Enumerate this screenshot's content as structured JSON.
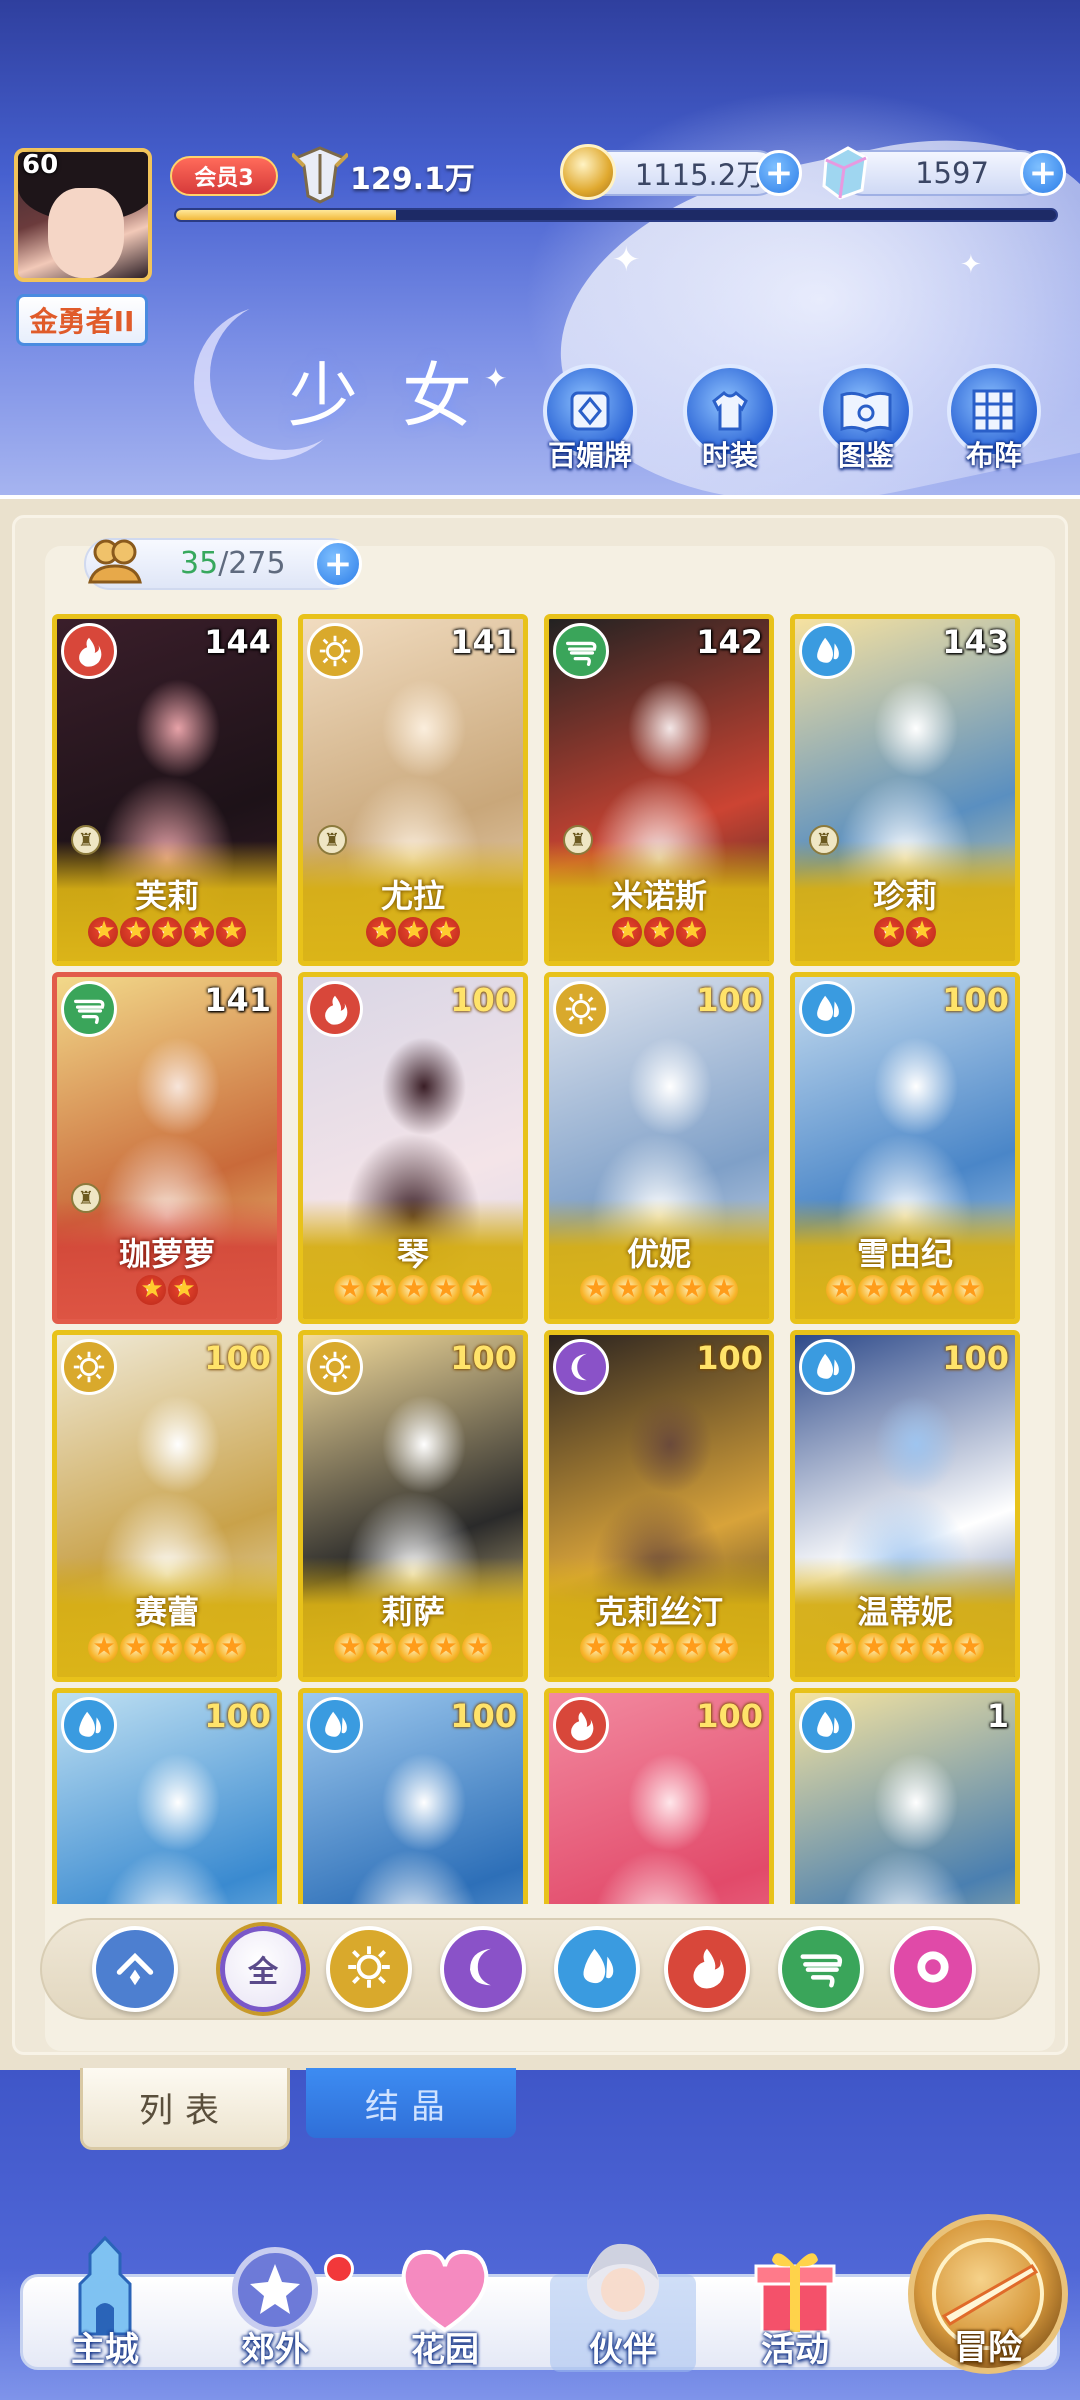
{
  "player": {
    "level": "60",
    "rank": "金勇者II",
    "vip": "会员3",
    "power": "129.1万",
    "exp_progress": 0.25
  },
  "resources": {
    "gold": "1115.2万",
    "gems": "1597"
  },
  "page": {
    "title": "少女"
  },
  "top_menu": [
    {
      "label": "百媚牌",
      "icon": "card-deck-icon"
    },
    {
      "label": "时装",
      "icon": "outfit-icon"
    },
    {
      "label": "图鉴",
      "icon": "codex-book-icon"
    },
    {
      "label": "布阵",
      "icon": "formation-grid-icon"
    }
  ],
  "capacity": {
    "current": "35",
    "max": "/275"
  },
  "cards": [
    {
      "name": "芙莉",
      "level": "144",
      "element": "fire",
      "stars": 5,
      "star_style": "red",
      "frame": "gold"
    },
    {
      "name": "尤拉",
      "level": "141",
      "element": "light",
      "stars": 3,
      "star_style": "red",
      "frame": "gold"
    },
    {
      "name": "米诺斯",
      "level": "142",
      "element": "wind",
      "stars": 3,
      "star_style": "red",
      "frame": "gold"
    },
    {
      "name": "珍莉",
      "level": "143",
      "element": "water",
      "stars": 2,
      "star_style": "red",
      "frame": "gold"
    },
    {
      "name": "珈萝萝",
      "level": "141",
      "element": "wind",
      "stars": 2,
      "star_style": "red",
      "frame": "red"
    },
    {
      "name": "琴",
      "level": "100",
      "element": "fire",
      "stars": 5,
      "star_style": "gold",
      "frame": "gold"
    },
    {
      "name": "优妮",
      "level": "100",
      "element": "light",
      "stars": 5,
      "star_style": "gold",
      "frame": "gold"
    },
    {
      "name": "雪由纪",
      "level": "100",
      "element": "water",
      "stars": 5,
      "star_style": "gold",
      "frame": "gold"
    },
    {
      "name": "赛蕾",
      "level": "100",
      "element": "light",
      "stars": 5,
      "star_style": "gold",
      "frame": "gold"
    },
    {
      "name": "莉萨",
      "level": "100",
      "element": "light",
      "stars": 5,
      "star_style": "gold",
      "frame": "gold"
    },
    {
      "name": "克莉丝汀",
      "level": "100",
      "element": "dark",
      "stars": 5,
      "star_style": "gold",
      "frame": "gold"
    },
    {
      "name": "温蒂妮",
      "level": "100",
      "element": "water",
      "stars": 5,
      "star_style": "gold",
      "frame": "gold"
    },
    {
      "name": "",
      "level": "100",
      "element": "water",
      "stars": 0,
      "star_style": "gold",
      "frame": "gold"
    },
    {
      "name": "",
      "level": "100",
      "element": "water",
      "stars": 0,
      "star_style": "gold",
      "frame": "gold"
    },
    {
      "name": "",
      "level": "100",
      "element": "fire",
      "stars": 0,
      "star_style": "gold",
      "frame": "gold"
    },
    {
      "name": "",
      "level": "1",
      "element": "water",
      "stars": 0,
      "star_style": "gold",
      "frame": "gold"
    }
  ],
  "filters": [
    {
      "id": "collapse",
      "label": "",
      "icon": "chevron-up-icon"
    },
    {
      "id": "all",
      "label": "全",
      "icon": "all-icon",
      "selected": true
    },
    {
      "id": "light",
      "label": "",
      "icon": "sun-icon"
    },
    {
      "id": "dark",
      "label": "",
      "icon": "moon-icon"
    },
    {
      "id": "water",
      "label": "",
      "icon": "water-drop-icon"
    },
    {
      "id": "fire",
      "label": "",
      "icon": "fire-icon"
    },
    {
      "id": "wind",
      "label": "",
      "icon": "wind-icon"
    },
    {
      "id": "special",
      "label": "",
      "icon": "pink-orb-icon"
    }
  ],
  "tabs": {
    "list": "列表",
    "crystal": "结晶"
  },
  "nav": [
    {
      "label": "主城",
      "icon": "castle-icon"
    },
    {
      "label": "郊外",
      "icon": "portal-icon"
    },
    {
      "label": "花园",
      "icon": "heart-garden-icon"
    },
    {
      "label": "伙伴",
      "icon": "partner-portrait-icon",
      "active": true
    },
    {
      "label": "活动",
      "icon": "gift-box-icon"
    },
    {
      "label": "冒险",
      "icon": "compass-sword-icon"
    }
  ],
  "colors": {
    "fire": "#d8473a",
    "light": "#d9a92c",
    "wind": "#3aa55a",
    "water": "#3a9be0",
    "dark": "#8a52c8",
    "special": "#e04aa8",
    "collapse": "#4d7fd0"
  }
}
